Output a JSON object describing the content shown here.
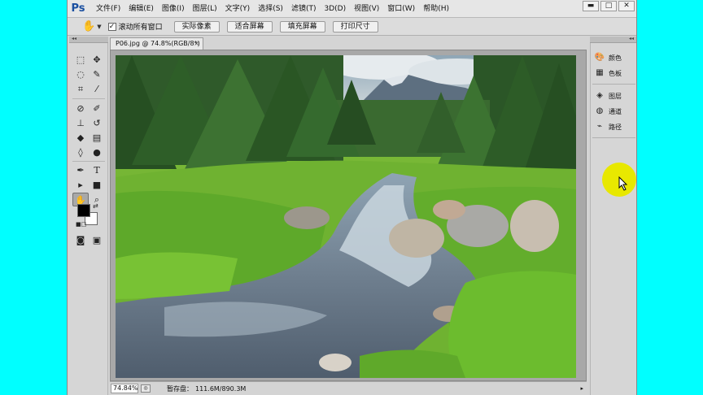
{
  "app": {
    "logo": "Ps"
  },
  "menu": [
    "文件(F)",
    "编辑(E)",
    "图像(I)",
    "图层(L)",
    "文字(Y)",
    "选择(S)",
    "滤镜(T)",
    "3D(D)",
    "视图(V)",
    "窗口(W)",
    "帮助(H)"
  ],
  "window_controls": {
    "minimize": "▬",
    "maximize": "□",
    "close": "✕"
  },
  "options": {
    "scroll_all_label": "滚动所有窗口",
    "scroll_all_checked": true,
    "buttons": [
      "实际像素",
      "适合屏幕",
      "填充屏幕",
      "打印尺寸"
    ]
  },
  "document": {
    "tab_title": "P06.jpg @ 74.8%(RGB/8*)",
    "close_glyph": "×"
  },
  "status": {
    "zoom": "74.84%",
    "label": "暂存盘：",
    "value": "111.6M/890.3M"
  },
  "panels": [
    {
      "label": "颜色",
      "icon": "palette-icon"
    },
    {
      "label": "色板",
      "icon": "swatches-icon"
    },
    {
      "label": "图层",
      "icon": "layers-icon"
    },
    {
      "label": "通道",
      "icon": "channels-icon"
    },
    {
      "label": "路径",
      "icon": "paths-icon"
    }
  ],
  "colors": {
    "foreground": "#000000",
    "background": "#ffffff",
    "desktop": "#00ffff",
    "cursor_highlight": "#e8e800"
  }
}
